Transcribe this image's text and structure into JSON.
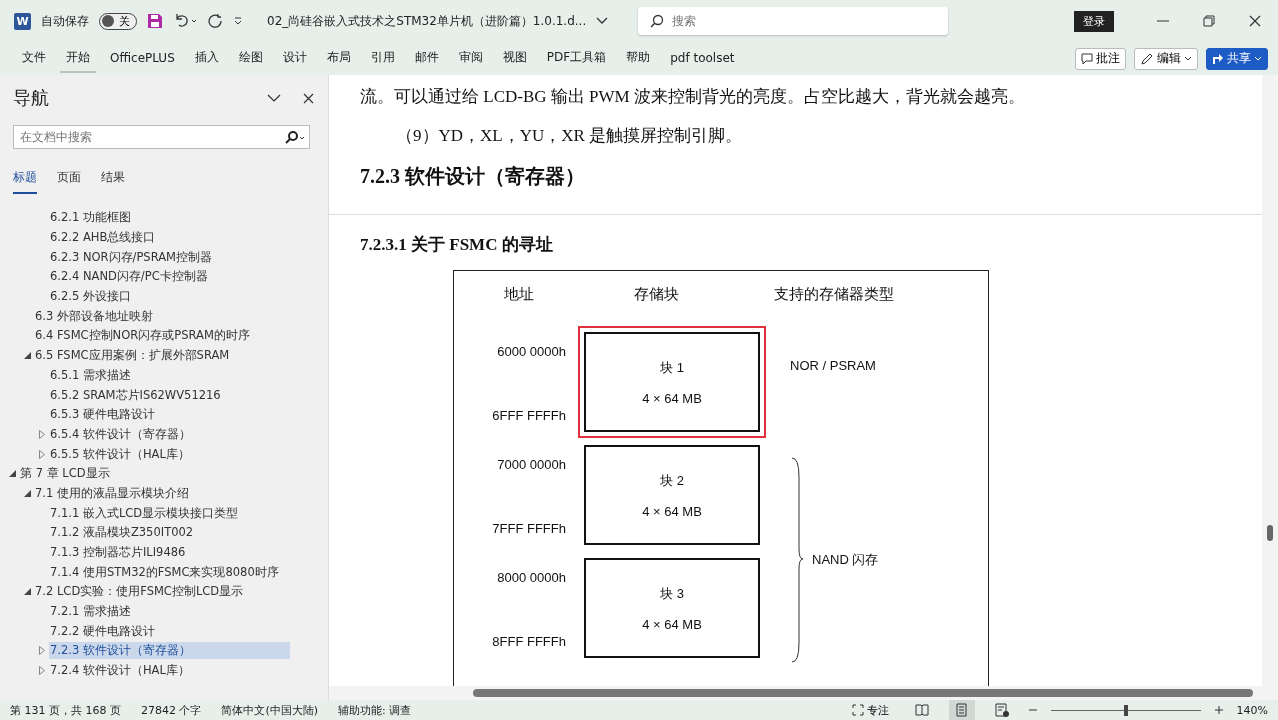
{
  "title_bar": {
    "app_logo": "W",
    "autosave_label": "自动保存",
    "autosave": {
      "on": false,
      "label": "关"
    },
    "document_title": "02_尚硅谷嵌入式技术之STM32单片机（进阶篇）1.0.1.d...",
    "search": {
      "placeholder": "搜索"
    },
    "sign_in": "登录"
  },
  "ribbon": {
    "tabs": [
      {
        "label": "文件",
        "selected": false
      },
      {
        "label": "开始",
        "selected": true
      },
      {
        "label": "OfficePLUS",
        "selected": false
      },
      {
        "label": "插入",
        "selected": false
      },
      {
        "label": "绘图",
        "selected": false
      },
      {
        "label": "设计",
        "selected": false
      },
      {
        "label": "布局",
        "selected": false
      },
      {
        "label": "引用",
        "selected": false
      },
      {
        "label": "邮件",
        "selected": false
      },
      {
        "label": "审阅",
        "selected": false
      },
      {
        "label": "视图",
        "selected": false
      },
      {
        "label": "PDF工具箱",
        "selected": false
      },
      {
        "label": "帮助",
        "selected": false
      },
      {
        "label": "pdf toolset",
        "selected": false
      }
    ],
    "comments_button": "批注",
    "editing_button": "编辑",
    "share_button": "共享"
  },
  "navigation": {
    "title": "导航",
    "search": {
      "placeholder": "在文档中搜索"
    },
    "tabs": [
      {
        "label": "标题",
        "selected": true
      },
      {
        "label": "页面",
        "selected": false
      },
      {
        "label": "结果",
        "selected": false
      }
    ],
    "outline": [
      {
        "children": [
          {
            "children": [
              {
                "label": "6.2.1 功能框图",
                "selected": false
              },
              {
                "label": "6.2.2 AHB总线接口",
                "selected": false
              },
              {
                "label": "6.2.3 NOR闪存/PSRAM控制器",
                "selected": false
              },
              {
                "label": "6.2.4 NAND闪存/PC卡控制器",
                "selected": false
              },
              {
                "label": "6.2.5 外设接口",
                "selected": false
              }
            ]
          },
          {
            "label": "6.3 外部设备地址映射",
            "selected": false
          },
          {
            "label": "6.4 FSMC控制NOR闪存或PSRAM的时序",
            "selected": false
          },
          {
            "label": "6.5 FSMC应用案例：扩展外部SRAM",
            "selected": false,
            "expanded": true,
            "children": [
              {
                "label": "6.5.1 需求描述",
                "selected": false
              },
              {
                "label": "6.5.2 SRAM芯片IS62WV51216",
                "selected": false
              },
              {
                "label": "6.5.3 硬件电路设计",
                "selected": false
              },
              {
                "label": "6.5.4 软件设计（寄存器）",
                "selected": false,
                "expanded": false
              },
              {
                "label": "6.5.5 软件设计（HAL库）",
                "selected": false,
                "expanded": false
              }
            ]
          }
        ]
      },
      {
        "label": "第 7 章 LCD显示",
        "selected": false,
        "expanded": true,
        "children": [
          {
            "label": "7.1 使用的液晶显示模块介绍",
            "selected": false,
            "expanded": true,
            "children": [
              {
                "label": "7.1.1 嵌入式LCD显示模块接口类型",
                "selected": false
              },
              {
                "label": "7.1.2 液晶模块Z350IT002",
                "selected": false
              },
              {
                "label": "7.1.3 控制器芯片ILI9486",
                "selected": false
              },
              {
                "label": "7.1.4 使用STM32的FSMC来实现8080时序",
                "selected": false
              }
            ]
          },
          {
            "label": "7.2 LCD实验：使用FSMC控制LCD显示",
            "selected": false,
            "expanded": true,
            "children": [
              {
                "label": "7.2.1 需求描述",
                "selected": false
              },
              {
                "label": "7.2.2 硬件电路设计",
                "selected": false
              },
              {
                "label": "7.2.3 软件设计（寄存器）",
                "selected": true,
                "expanded": false
              },
              {
                "label": "7.2.4 软件设计（HAL库）",
                "selected": false,
                "expanded": false
              }
            ]
          }
        ]
      }
    ]
  },
  "document": {
    "blocks": [
      {
        "kind": "paragraph",
        "text": "流。可以通过给 LCD-BG 输出 PWM 波来控制背光的亮度。占空比越大，背光就会越亮。"
      },
      {
        "kind": "indented",
        "text": "（9）YD，XL，YU，XR 是触摸屏控制引脚。"
      },
      {
        "kind": "heading3",
        "text": "7.2.3 软件设计（寄存器）"
      },
      {
        "kind": "pagebreak"
      },
      {
        "kind": "heading4",
        "text": "7.2.3.1 关于 FSMC 的寻址"
      }
    ],
    "figure": {
      "columns": [
        "地址",
        "存储块",
        "支持的存储器类型"
      ],
      "groups": [
        {
          "type": "NOR / PSRAM",
          "blocks": [
            {
              "start": "6000 0000h",
              "end": "6FFF FFFFh",
              "name": "块 1",
              "size": "4 × 64 MB",
              "highlighted": true
            }
          ]
        },
        {
          "type": "NAND 闪存",
          "blocks": [
            {
              "start": "7000 0000h",
              "end": "7FFF FFFFh",
              "name": "块 2",
              "size": "4 × 64 MB",
              "highlighted": false
            },
            {
              "start": "8000 0000h",
              "end": "8FFF FFFFh",
              "name": "块 3",
              "size": "4 × 64 MB",
              "highlighted": false
            }
          ]
        }
      ]
    }
  },
  "status_bar": {
    "page": "第 131 页，共 168 页",
    "words": "27842 个字",
    "language": "简体中文(中国大陆)",
    "accessibility": "辅助功能: 调查",
    "focus": "专注",
    "views": [
      {
        "kind": "read",
        "selected": false
      },
      {
        "kind": "print",
        "selected": true
      },
      {
        "kind": "web",
        "selected": false
      }
    ],
    "zoom": {
      "level": 0.5,
      "reading": "140%"
    }
  }
}
